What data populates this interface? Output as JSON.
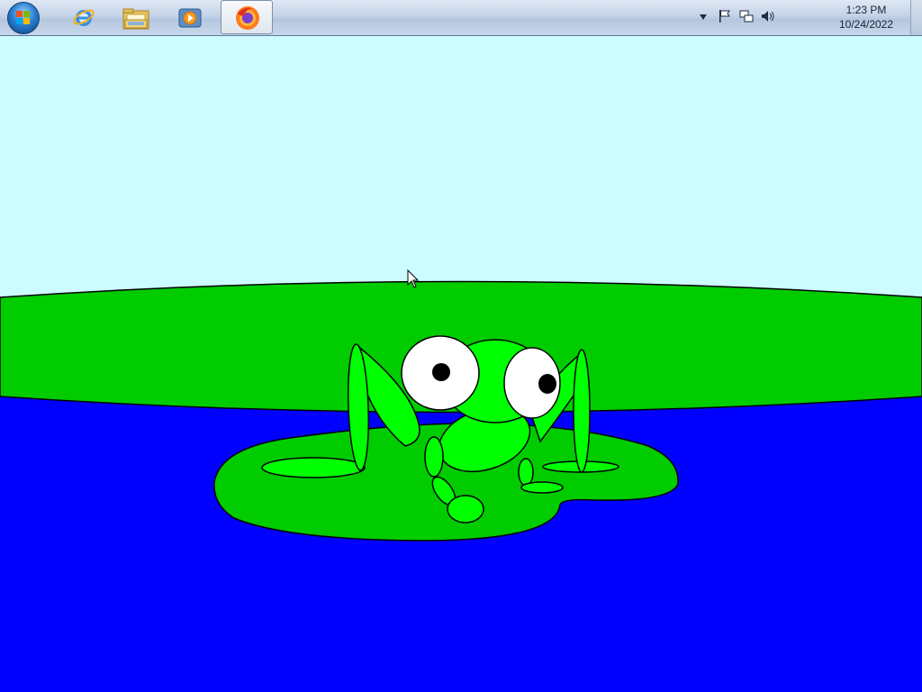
{
  "taskbar": {
    "pinned": [
      {
        "icon": "start-orb-icon"
      },
      {
        "icon": "internet-explorer-icon"
      },
      {
        "icon": "file-explorer-icon"
      },
      {
        "icon": "media-player-icon"
      },
      {
        "icon": "firefox-icon",
        "active": true
      }
    ],
    "tray": {
      "icons": [
        "chevron-up-icon",
        "action-center-flag-icon",
        "network-icon",
        "volume-icon"
      ],
      "time": "1:23 PM",
      "date": "10/24/2022"
    }
  },
  "scene": {
    "colors": {
      "sky": "#ccfcff",
      "grass": "#00cc00",
      "water": "#0000ff",
      "frog": "#00ff00",
      "lily_pad": "#00cc00",
      "outline": "#000000"
    }
  }
}
